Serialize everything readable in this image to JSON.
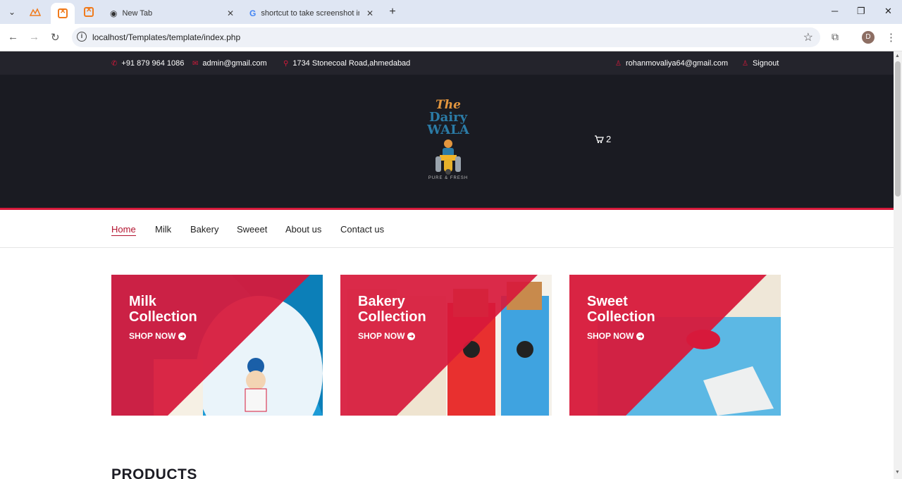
{
  "browser": {
    "tabs": [
      {
        "title": "New Tab",
        "icon": "chrome-icon"
      },
      {
        "title": "shortcut to take screenshot in w",
        "icon": "google-icon"
      }
    ],
    "url": "localhost/Templates/template/index.php",
    "profile_initial": "D"
  },
  "topbar": {
    "phone": "+91 879 964 1086",
    "email": "admin@gmail.com",
    "address": "1734 Stonecoal Road,ahmedabad",
    "user_email": "rohanmovaliya64@gmail.com",
    "signout": "Signout"
  },
  "header": {
    "logo": {
      "line1": "The",
      "line2": "Dairy",
      "line3": "WALA",
      "tagline": "PURE & FRESH"
    },
    "cart_count": "2"
  },
  "nav": {
    "items": [
      "Home",
      "Milk",
      "Bakery",
      "Sweeet",
      "About us",
      "Contact us"
    ],
    "active": "Home"
  },
  "banners": [
    {
      "title_line1": "Milk",
      "title_line2": "Collection",
      "cta": "SHOP NOW"
    },
    {
      "title_line1": "Bakery",
      "title_line2": "Collection",
      "cta": "SHOP NOW"
    },
    {
      "title_line1": "Sweet",
      "title_line2": "Collection",
      "cta": "SHOP NOW"
    }
  ],
  "products_heading": "PRODUCTS",
  "colors": {
    "accent": "#d7193b",
    "dark": "#1a1b22",
    "topbar": "#24242c"
  }
}
